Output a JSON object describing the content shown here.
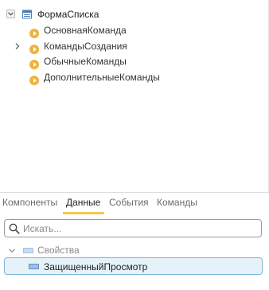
{
  "tree": {
    "root": {
      "label": "ФормаСписка",
      "expanded": true,
      "icon": "form-icon"
    },
    "children": [
      {
        "label": "ОсновнаяКоманда",
        "icon": "command-icon",
        "expandable": false
      },
      {
        "label": "КомандыСоздания",
        "icon": "command-icon",
        "expandable": true
      },
      {
        "label": "ОбычныеКоманды",
        "icon": "command-icon",
        "expandable": false
      },
      {
        "label": "ДополнительныеКоманды",
        "icon": "command-icon",
        "expandable": false
      }
    ]
  },
  "tabs": [
    {
      "label": "Компоненты",
      "active": false
    },
    {
      "label": "Данные",
      "active": true
    },
    {
      "label": "События",
      "active": false
    },
    {
      "label": "Команды",
      "active": false
    }
  ],
  "search": {
    "placeholder": "Искать...",
    "value": ""
  },
  "data_tree": {
    "group": {
      "label": "Свойства",
      "expanded": true
    },
    "items": [
      {
        "label": "ЗащищенныйПросмотр",
        "selected": true
      }
    ]
  },
  "colors": {
    "command_icon": "#f0b23c",
    "tab_underline": "#f2c94c",
    "selection_bg": "#e6f2fa",
    "selection_border": "#7fb3da",
    "attribute_icon": "#9cc0e6"
  }
}
